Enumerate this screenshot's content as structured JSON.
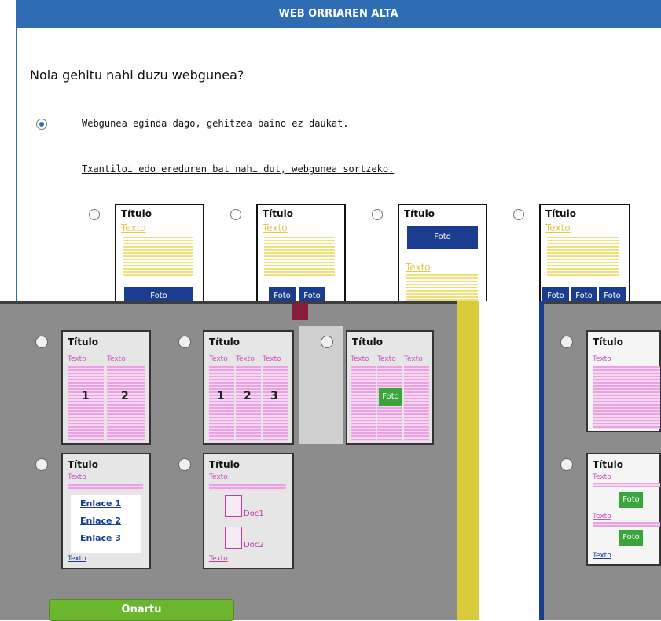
{
  "header": {
    "title": "WEB ORRIAREN ALTA"
  },
  "question": "Nola gehitu nahi duzu webgunea?",
  "option_existing": {
    "label": "Webgunea eginda dago, gehitzea baino ez daukat.",
    "selected": true
  },
  "template_link": "Txantiloi edo ereduren bat nahi dut, webgunea sortzeko.",
  "top_templates": [
    {
      "title": "Título",
      "text": "Texto",
      "foto": "Foto"
    },
    {
      "title": "Título",
      "text": "Texto",
      "foto1": "Foto",
      "foto2": "Foto"
    },
    {
      "title": "Título",
      "foto": "Foto",
      "text": "Texto"
    },
    {
      "title": "Título",
      "text": "Texto",
      "foto1": "Foto",
      "foto2": "Foto",
      "foto3": "Foto"
    }
  ],
  "lower_templates": {
    "two_col": {
      "title": "Título",
      "col1": "Texto",
      "col2": "Texto",
      "n1": "1",
      "n2": "2"
    },
    "three_col": {
      "title": "Título",
      "col1": "Texto",
      "col2": "Texto",
      "col3": "Texto",
      "n1": "1",
      "n2": "2",
      "n3": "3"
    },
    "three_col_foto": {
      "title": "Título",
      "col1": "Texto",
      "col2": "Texto",
      "col3": "Texto",
      "foto": "Foto"
    },
    "single_col": {
      "title": "Título",
      "text": "Texto"
    },
    "links": {
      "title": "Título",
      "text": "Texto",
      "link1": "Enlace 1",
      "link2": "Enlace 2",
      "link3": "Enlace 3",
      "footer": "Texto"
    },
    "docs": {
      "title": "Título",
      "text": "Texto",
      "doc1": "Doc1",
      "doc2": "Doc2",
      "footer": "Texto"
    },
    "fotos": {
      "title": "Título",
      "text1": "Texto",
      "foto1": "Foto",
      "text2": "Texto",
      "foto2": "Foto",
      "footer": "Texto"
    }
  },
  "accept_button": "Onartu",
  "colors": {
    "header": "#2e6db4",
    "accent_gray": "#8c8c8c",
    "button": "#6bb52f"
  }
}
